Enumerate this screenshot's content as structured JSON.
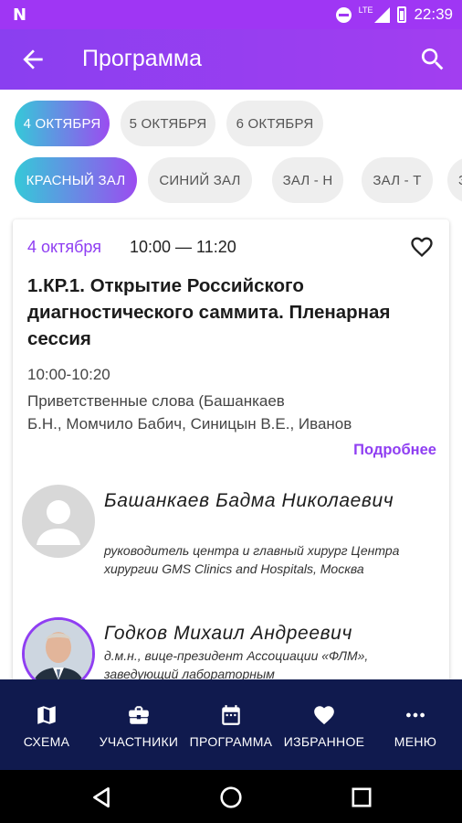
{
  "status_bar": {
    "time": "22:39",
    "network": "LTE"
  },
  "app_bar": {
    "title": "Программа"
  },
  "date_chips": [
    {
      "label": "4 ОКТЯБРЯ",
      "active": true
    },
    {
      "label": "5 ОКТЯБРЯ",
      "active": false
    },
    {
      "label": "6 ОКТЯБРЯ",
      "active": false
    }
  ],
  "hall_chips": [
    {
      "label": "КРАСНЫЙ ЗАЛ",
      "active": true
    },
    {
      "label": "СИНИЙ ЗАЛ",
      "active": false
    },
    {
      "label": "ЗАЛ - Н",
      "active": false
    },
    {
      "label": "ЗАЛ - Т",
      "active": false
    },
    {
      "label": "З",
      "active": false
    }
  ],
  "session": {
    "date": "4 октября",
    "time": "10:00 — 11:20",
    "title": "1.КР.1. Открытие Российского диагностического саммита. Пленарная сессия",
    "item_time": "10:00-10:20",
    "item_desc_line1": "Приветственные слова (Башанкаев",
    "item_desc_line2": "Б.Н., Момчило Бабич, Синицын В.Е., Иванов",
    "more_label": "Подробнее"
  },
  "speakers": [
    {
      "name": "Башанкаев Бадма Николаевич",
      "role": "руководитель центра и главный хирург Центра хирургии GMS Clinics and Hospitals, Москва"
    },
    {
      "name": "Годков Михаил Андреевич",
      "role": "д.м.н., вице-президент Ассоциации «ФЛМ», заведующий лабораторным"
    }
  ],
  "bottom_nav": [
    {
      "label": "СХЕМА",
      "icon": "map-icon"
    },
    {
      "label": "УЧАСТНИКИ",
      "icon": "briefcase-icon"
    },
    {
      "label": "ПРОГРАММА",
      "icon": "calendar-icon"
    },
    {
      "label": "ИЗБРАННОЕ",
      "icon": "heart-icon"
    },
    {
      "label": "МЕНЮ",
      "icon": "more-dots-icon"
    }
  ],
  "colors": {
    "accent": "#8f3ef2",
    "app_bar": "#9f3ef2",
    "bottom_nav": "#101a4e",
    "chip_gradient_start": "#35c9d8",
    "chip_gradient_end": "#9b4cf0"
  }
}
